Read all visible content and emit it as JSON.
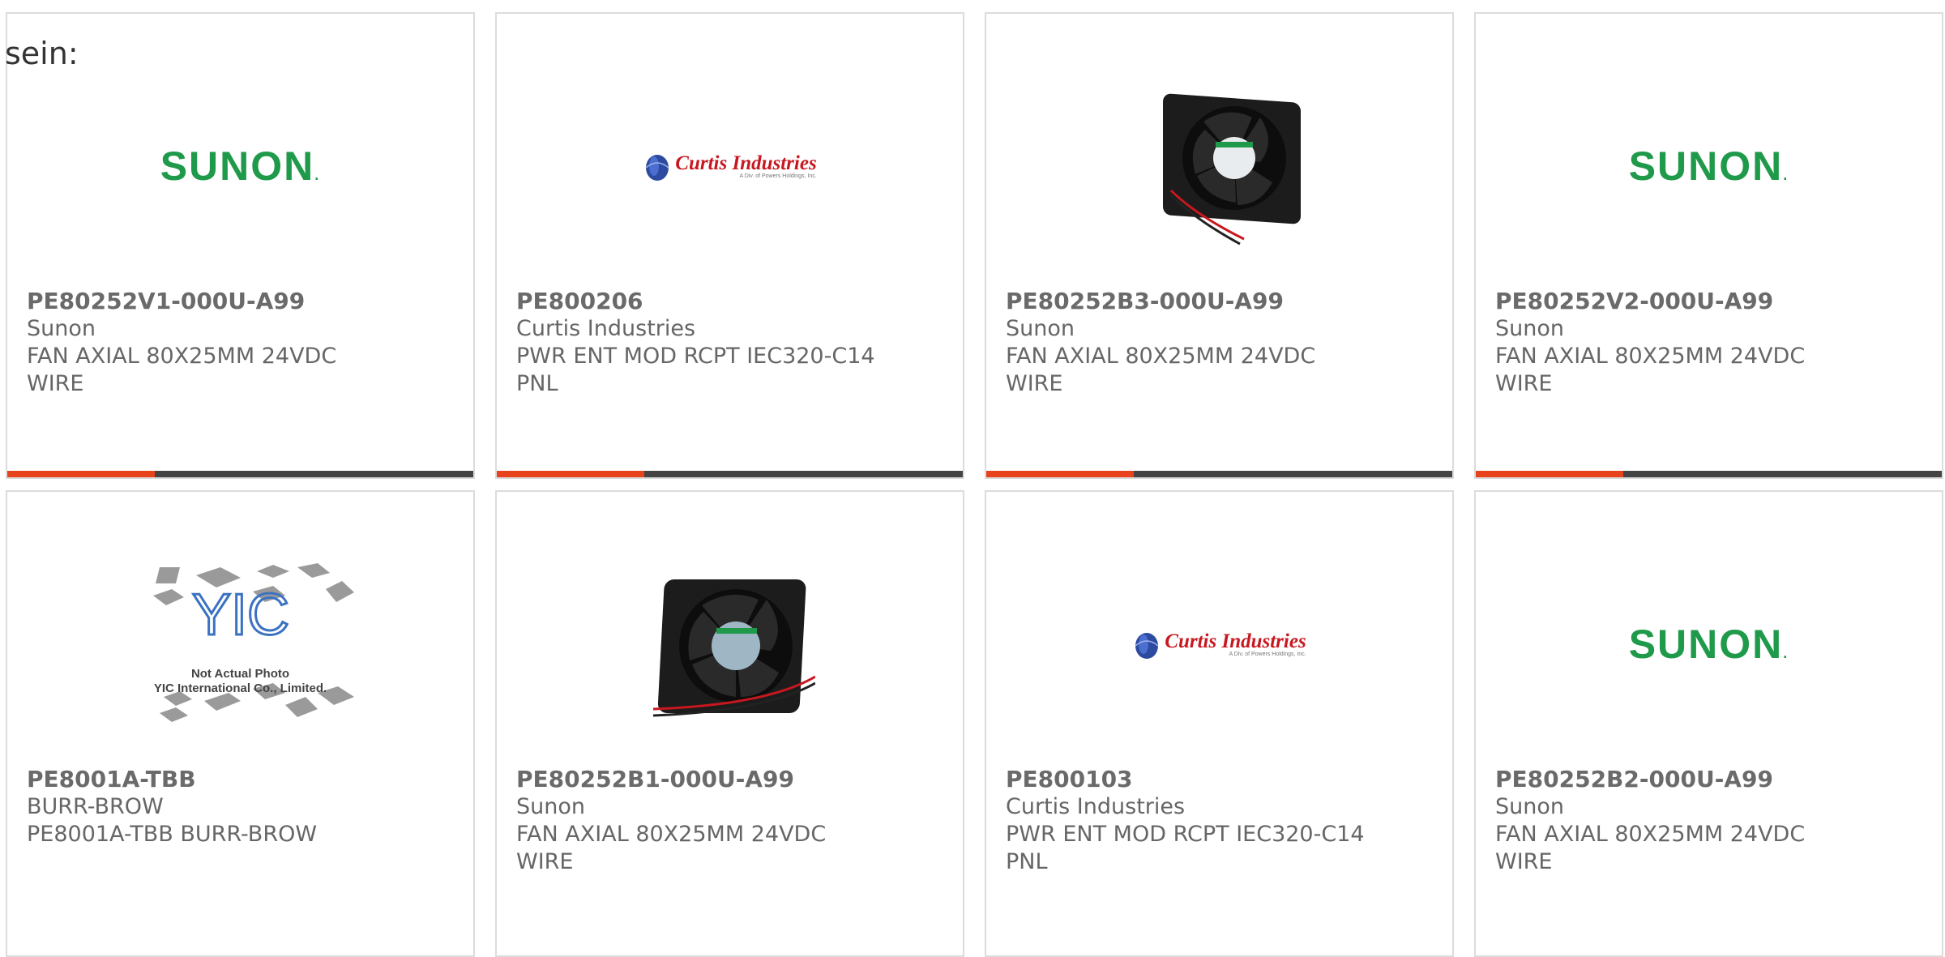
{
  "lead_text": "sein:",
  "products": [
    {
      "part": "PE80252V1-000U-A99",
      "maker": "Sunon",
      "desc1": "FAN AXIAL 80X25MM 24VDC",
      "desc2": "WIRE",
      "image": "sunon-logo"
    },
    {
      "part": "PE800206",
      "maker": "Curtis Industries",
      "desc1": "PWR ENT MOD RCPT IEC320-C14",
      "desc2": "PNL",
      "image": "curtis-logo"
    },
    {
      "part": "PE80252B3-000U-A99",
      "maker": "Sunon",
      "desc1": "FAN AXIAL 80X25MM 24VDC",
      "desc2": "WIRE",
      "image": "fan-photo"
    },
    {
      "part": "PE80252V2-000U-A99",
      "maker": "Sunon",
      "desc1": "FAN AXIAL 80X25MM 24VDC",
      "desc2": "WIRE",
      "image": "sunon-logo"
    },
    {
      "part": "PE8001A-TBB",
      "maker": "BURR-BROW",
      "desc1": "PE8001A-TBB BURR-BROW",
      "desc2": "",
      "image": "yic-placeholder"
    },
    {
      "part": "PE80252B1-000U-A99",
      "maker": "Sunon",
      "desc1": "FAN AXIAL 80X25MM 24VDC",
      "desc2": "WIRE",
      "image": "fan-photo"
    },
    {
      "part": "PE800103",
      "maker": "Curtis Industries",
      "desc1": "PWR ENT MOD RCPT IEC320-C14",
      "desc2": "PNL",
      "image": "curtis-logo"
    },
    {
      "part": "PE80252B2-000U-A99",
      "maker": "Sunon",
      "desc1": "FAN AXIAL 80X25MM 24VDC",
      "desc2": "WIRE",
      "image": "sunon-logo"
    }
  ],
  "logos": {
    "sunon": "SUNON",
    "sunon_dot": ".",
    "curtis": "Curtis Industries",
    "curtis_sub": "A Div. of Powers Holdings, Inc.",
    "yic_mark": "YIC",
    "yic_line1": "Not Actual Photo",
    "yic_line2": "YIC International Co., Limited."
  },
  "colors": {
    "accent": "#e8431c",
    "bar": "#444444",
    "sunon_green": "#1f9a4a",
    "curtis_red": "#c8171f"
  }
}
